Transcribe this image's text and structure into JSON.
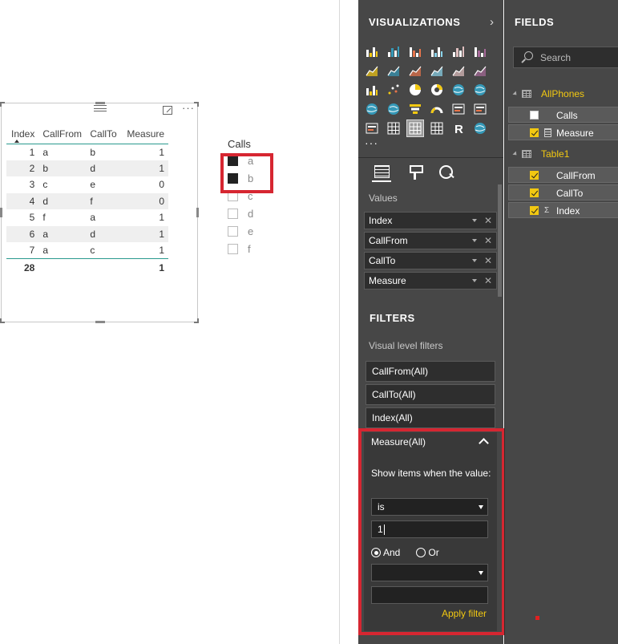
{
  "table": {
    "headers": [
      "Index",
      "CallFrom",
      "CallTo",
      "Measure"
    ],
    "rows": [
      [
        "1",
        "a",
        "b",
        "1"
      ],
      [
        "2",
        "b",
        "d",
        "1"
      ],
      [
        "3",
        "c",
        "e",
        "0"
      ],
      [
        "4",
        "d",
        "f",
        "0"
      ],
      [
        "5",
        "f",
        "a",
        "1"
      ],
      [
        "6",
        "a",
        "d",
        "1"
      ],
      [
        "7",
        "a",
        "c",
        "1"
      ]
    ],
    "totals": {
      "index": "28",
      "measure": "1"
    },
    "more_glyph": "···"
  },
  "slicer": {
    "title": "Calls",
    "items": [
      {
        "label": "a",
        "checked": true
      },
      {
        "label": "b",
        "checked": true
      },
      {
        "label": "c",
        "checked": false
      },
      {
        "label": "d",
        "checked": false
      },
      {
        "label": "e",
        "checked": false
      },
      {
        "label": "f",
        "checked": false
      }
    ]
  },
  "visualizations": {
    "title": "VISUALIZATIONS",
    "chevron": "›",
    "more": "···",
    "icons": [
      "stacked-bar-chart-icon",
      "stacked-column-chart-icon",
      "clustered-bar-chart-icon",
      "clustered-column-chart-icon",
      "100-stacked-bar-chart-icon",
      "100-stacked-column-chart-icon",
      "line-chart-icon",
      "area-chart-icon",
      "stacked-area-chart-icon",
      "line-column-chart-icon",
      "line-clustered-column-chart-icon",
      "ribbon-chart-icon",
      "waterfall-chart-icon",
      "scatter-chart-icon",
      "pie-chart-icon",
      "donut-chart-icon",
      "treemap-icon",
      "map-icon",
      "filled-map-icon",
      "shape-map-icon",
      "funnel-icon",
      "gauge-icon",
      "card-icon",
      "multi-row-card-icon",
      "kpi-icon",
      "slicer-icon",
      "table-icon",
      "matrix-icon",
      "r-visual-icon",
      "globe-icon"
    ],
    "selected_icon": "table-icon",
    "values_label": "Values",
    "wells": [
      "Index",
      "CallFrom",
      "CallTo",
      "Measure"
    ],
    "well_remove": "✕"
  },
  "filters": {
    "title": "FILTERS",
    "visual_level_label": "Visual level filters",
    "cards": [
      "CallFrom(All)",
      "CallTo(All)",
      "Index(All)"
    ],
    "measure": {
      "title": "Measure(All)",
      "show_items_label": "Show items when the value:",
      "condition": "is",
      "value": "1",
      "and_label": "And",
      "or_label": "Or",
      "second_condition": "",
      "second_value": "",
      "apply_label": "Apply filter"
    }
  },
  "fields": {
    "title": "FIELDS",
    "search_placeholder": "Search",
    "tables": [
      {
        "name": "AllPhones",
        "fields": [
          {
            "name": "Calls",
            "checked": false,
            "icon": ""
          },
          {
            "name": "Measure",
            "checked": true,
            "icon": "calculator-icon"
          }
        ]
      },
      {
        "name": "Table1",
        "fields": [
          {
            "name": "CallFrom",
            "checked": true,
            "icon": ""
          },
          {
            "name": "CallTo",
            "checked": true,
            "icon": ""
          },
          {
            "name": "Index",
            "checked": true,
            "icon": "sigma-icon"
          }
        ]
      }
    ]
  },
  "colors": {
    "accent_yellow": "#f2c811",
    "highlight_red": "#d62631",
    "table_rule": "#2a9a8e",
    "pane_bg": "#474747"
  }
}
